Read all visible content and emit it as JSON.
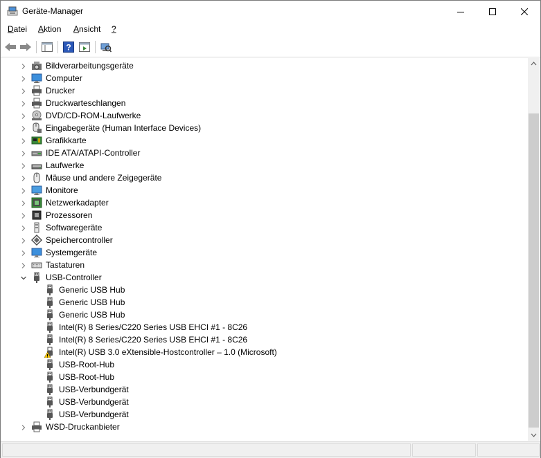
{
  "window": {
    "title": "Geräte-Manager"
  },
  "menu": {
    "items": [
      {
        "label": "Datei"
      },
      {
        "label": "Aktion"
      },
      {
        "label": "Ansicht"
      },
      {
        "label": "?"
      }
    ]
  },
  "tree": {
    "rows": [
      {
        "label": "Bildverarbeitungsgeräte",
        "icon": "camera-icon"
      },
      {
        "label": "Computer",
        "icon": "computer-icon"
      },
      {
        "label": "Drucker",
        "icon": "printer-icon"
      },
      {
        "label": "Druckwarteschlangen",
        "icon": "printer-icon"
      },
      {
        "label": "DVD/CD-ROM-Laufwerke",
        "icon": "dvd-icon"
      },
      {
        "label": "Eingabegeräte (Human Interface Devices)",
        "icon": "hid-icon"
      },
      {
        "label": "Grafikkarte",
        "icon": "display-adapter-icon"
      },
      {
        "label": "IDE ATA/ATAPI-Controller",
        "icon": "ide-controller-icon"
      },
      {
        "label": "Laufwerke",
        "icon": "disk-drive-icon"
      },
      {
        "label": "Mäuse und andere Zeigegeräte",
        "icon": "mouse-icon"
      },
      {
        "label": "Monitore",
        "icon": "monitor-icon"
      },
      {
        "label": "Netzwerkadapter",
        "icon": "network-adapter-icon"
      },
      {
        "label": "Prozessoren",
        "icon": "processor-icon"
      },
      {
        "label": "Softwaregeräte",
        "icon": "software-device-icon"
      },
      {
        "label": "Speichercontroller",
        "icon": "storage-controller-icon"
      },
      {
        "label": "Systemgeräte",
        "icon": "system-device-icon"
      },
      {
        "label": "Tastaturen",
        "icon": "keyboard-icon"
      },
      {
        "label": "USB-Controller",
        "icon": "usb-icon",
        "expanded": true
      },
      {
        "label": "Generic USB Hub",
        "icon": "usb-icon",
        "child": true
      },
      {
        "label": "Generic USB Hub",
        "icon": "usb-icon",
        "child": true
      },
      {
        "label": "Generic USB Hub",
        "icon": "usb-icon",
        "child": true
      },
      {
        "label": "Intel(R) 8 Series/C220 Series USB EHCI #1 - 8C26",
        "icon": "usb-icon",
        "child": true
      },
      {
        "label": "Intel(R) 8 Series/C220 Series USB EHCI #1 - 8C26",
        "icon": "usb-icon",
        "child": true
      },
      {
        "label": "Intel(R) USB 3.0 eXtensible-Hostcontroller – 1.0 (Microsoft)",
        "icon": "usb-warning-icon",
        "child": true,
        "warning": true
      },
      {
        "label": "USB-Root-Hub",
        "icon": "usb-icon",
        "child": true
      },
      {
        "label": "USB-Root-Hub",
        "icon": "usb-icon",
        "child": true
      },
      {
        "label": "USB-Verbundgerät",
        "icon": "usb-icon",
        "child": true
      },
      {
        "label": "USB-Verbundgerät",
        "icon": "usb-icon",
        "child": true
      },
      {
        "label": "USB-Verbundgerät",
        "icon": "usb-icon",
        "child": true
      },
      {
        "label": "WSD-Druckanbieter",
        "icon": "printer-icon"
      }
    ]
  },
  "colors": {
    "accent": "#0063b1",
    "warning": "#f5c400",
    "icon_gray": "#5a5a5a"
  }
}
